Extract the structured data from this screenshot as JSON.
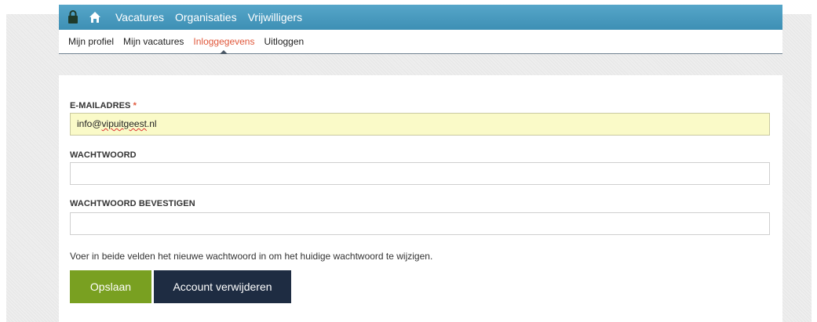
{
  "nav": {
    "items": [
      "Vacatures",
      "Organisaties",
      "Vrijwilligers"
    ]
  },
  "subnav": {
    "items": [
      "Mijn profiel",
      "Mijn vacatures",
      "Inloggegevens",
      "Uitloggen"
    ],
    "active": "Inloggegevens"
  },
  "form": {
    "email_label": "E-MAILADRES",
    "required_mark": "*",
    "email_value": "info@vipuitgeest.nl",
    "password_label": "WACHTWOORD",
    "password_value": "",
    "confirm_label": "WACHTWOORD BEVESTIGEN",
    "confirm_value": "",
    "help_text": "Voer in beide velden het nieuwe wachtwoord in om het huidige wachtwoord te wijzigen.",
    "save_label": "Opslaan",
    "delete_label": "Account verwijderen"
  },
  "colors": {
    "nav_bg": "#4a9bc0",
    "active_link": "#e0573a",
    "save_button": "#79a021",
    "delete_button": "#1e2c42",
    "autofill_bg": "#fafac8"
  },
  "icons": [
    "lock-icon",
    "home-icon"
  ]
}
